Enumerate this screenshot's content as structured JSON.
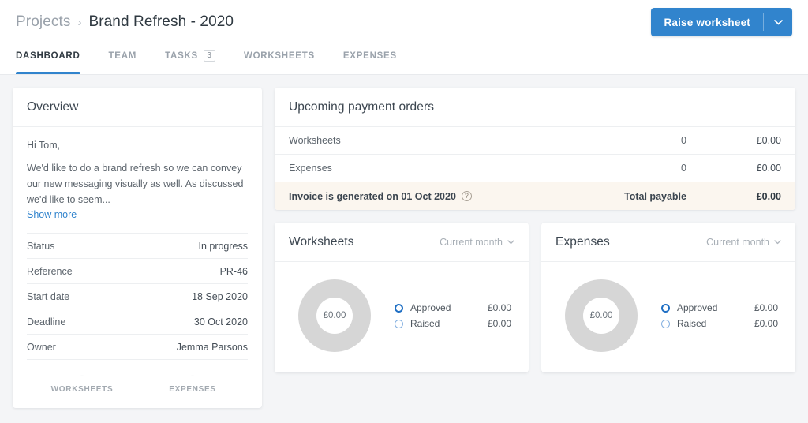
{
  "header": {
    "breadcrumb_root": "Projects",
    "breadcrumb_separator": "›",
    "title": "Brand Refresh - 2020",
    "primary_button": {
      "label": "Raise worksheet",
      "caret_icon": "chevron-down-icon",
      "color": "#3184cd"
    },
    "tabs": [
      {
        "label": "DASHBOARD",
        "badge": "",
        "active": true
      },
      {
        "label": "TEAM",
        "badge": "",
        "active": false
      },
      {
        "label": "TASKS",
        "badge": "3",
        "active": false
      },
      {
        "label": "WORKSHEETS",
        "badge": "",
        "active": false
      },
      {
        "label": "EXPENSES",
        "badge": "",
        "active": false
      }
    ]
  },
  "overview": {
    "title": "Overview",
    "greeting": "Hi Tom,",
    "body": "We'd like to do a brand refresh so we can convey our new messaging visually as well. As discussed we'd like to seem...",
    "show_more": "Show more",
    "meta": [
      {
        "label": "Status",
        "value": "In progress"
      },
      {
        "label": "Reference",
        "value": "PR-46"
      },
      {
        "label": "Start date",
        "value": "18 Sep 2020"
      },
      {
        "label": "Deadline",
        "value": "30 Oct 2020"
      },
      {
        "label": "Owner",
        "value": "Jemma Parsons"
      }
    ],
    "stats": [
      {
        "value": "-",
        "label": "WORKSHEETS"
      },
      {
        "value": "-",
        "label": "EXPENSES"
      }
    ]
  },
  "payment_orders": {
    "title": "Upcoming payment orders",
    "rows": [
      {
        "name": "Worksheets",
        "count": "0",
        "amount": "£0.00"
      },
      {
        "name": "Expenses",
        "count": "0",
        "amount": "£0.00"
      }
    ],
    "footer": {
      "note": "Invoice is generated on 01 Oct 2020",
      "help_icon": "help-circle-icon",
      "total_label": "Total payable",
      "total_amount": "£0.00",
      "background": "#fbf6ef"
    }
  },
  "worksheets_card": {
    "title": "Worksheets",
    "period": "Current month",
    "period_caret": "chevron-down-icon",
    "center_value": "£0.00",
    "legend": [
      {
        "label": "Approved",
        "value": "£0.00",
        "color": "#1f6fc4"
      },
      {
        "label": "Raised",
        "value": "£0.00",
        "color": "#85b0e0"
      }
    ]
  },
  "expenses_card": {
    "title": "Expenses",
    "period": "Current month",
    "period_caret": "chevron-down-icon",
    "center_value": "£0.00",
    "legend": [
      {
        "label": "Approved",
        "value": "£0.00",
        "color": "#1f6fc4"
      },
      {
        "label": "Raised",
        "value": "£0.00",
        "color": "#85b0e0"
      }
    ]
  },
  "chart_data": [
    {
      "type": "pie",
      "title": "Worksheets",
      "subtitle": "Current month",
      "labels": [
        "Approved",
        "Raised"
      ],
      "values": [
        0,
        0
      ],
      "center_label": "£0.00",
      "currency": "GBP",
      "legend_position": "right",
      "empty_state": true
    },
    {
      "type": "pie",
      "title": "Expenses",
      "subtitle": "Current month",
      "labels": [
        "Approved",
        "Raised"
      ],
      "values": [
        0,
        0
      ],
      "center_label": "£0.00",
      "currency": "GBP",
      "legend_position": "right",
      "empty_state": true
    }
  ]
}
